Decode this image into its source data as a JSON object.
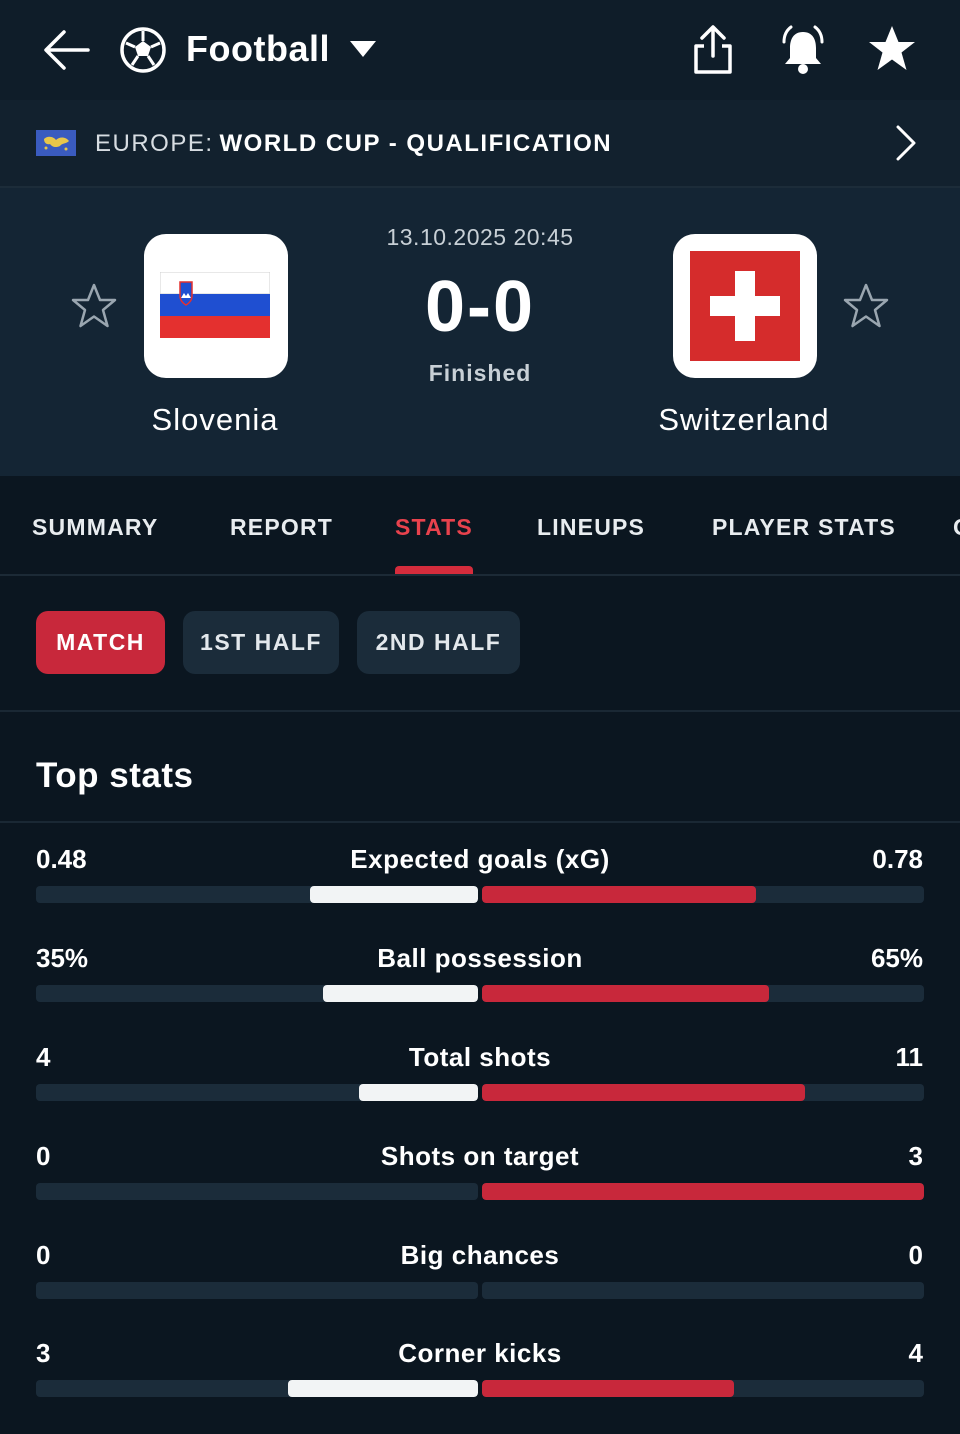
{
  "header": {
    "sport": "Football",
    "icons": [
      "back-arrow-icon",
      "soccer-ball-icon",
      "dropdown-caret-icon",
      "share-icon",
      "bell-icon",
      "star-icon"
    ]
  },
  "competition": {
    "region": "EUROPE:",
    "name": "WORLD CUP - QUALIFICATION"
  },
  "match": {
    "datetime": "13.10.2025 20:45",
    "score": "0-0",
    "status": "Finished",
    "home": {
      "name": "Slovenia"
    },
    "away": {
      "name": "Switzerland"
    }
  },
  "tabs": [
    {
      "label": "SUMMARY",
      "active": false
    },
    {
      "label": "REPORT",
      "active": false
    },
    {
      "label": "STATS",
      "active": true
    },
    {
      "label": "LINEUPS",
      "active": false
    },
    {
      "label": "PLAYER STATS",
      "active": false
    },
    {
      "label": "O",
      "active": false
    }
  ],
  "periods": [
    {
      "label": "MATCH",
      "active": true
    },
    {
      "label": "1ST HALF",
      "active": false
    },
    {
      "label": "2ND HALF",
      "active": false
    }
  ],
  "section": {
    "title": "Top stats"
  },
  "stats": [
    {
      "label": "Expected goals (xG)",
      "home": "0.48",
      "away": "0.78",
      "home_share": 0.38,
      "away_share": 0.62
    },
    {
      "label": "Ball possession",
      "home": "35%",
      "away": "65%",
      "home_share": 0.35,
      "away_share": 0.65
    },
    {
      "label": "Total shots",
      "home": "4",
      "away": "11",
      "home_share": 0.27,
      "away_share": 0.73
    },
    {
      "label": "Shots on target",
      "home": "0",
      "away": "3",
      "home_share": 0.0,
      "away_share": 1.0
    },
    {
      "label": "Big chances",
      "home": "0",
      "away": "0",
      "home_share": 0.0,
      "away_share": 0.0
    },
    {
      "label": "Corner kicks",
      "home": "3",
      "away": "4",
      "home_share": 0.43,
      "away_share": 0.57
    }
  ],
  "colors": {
    "accent": "#c8283b",
    "background": "#0b1620",
    "header": "#142534"
  }
}
